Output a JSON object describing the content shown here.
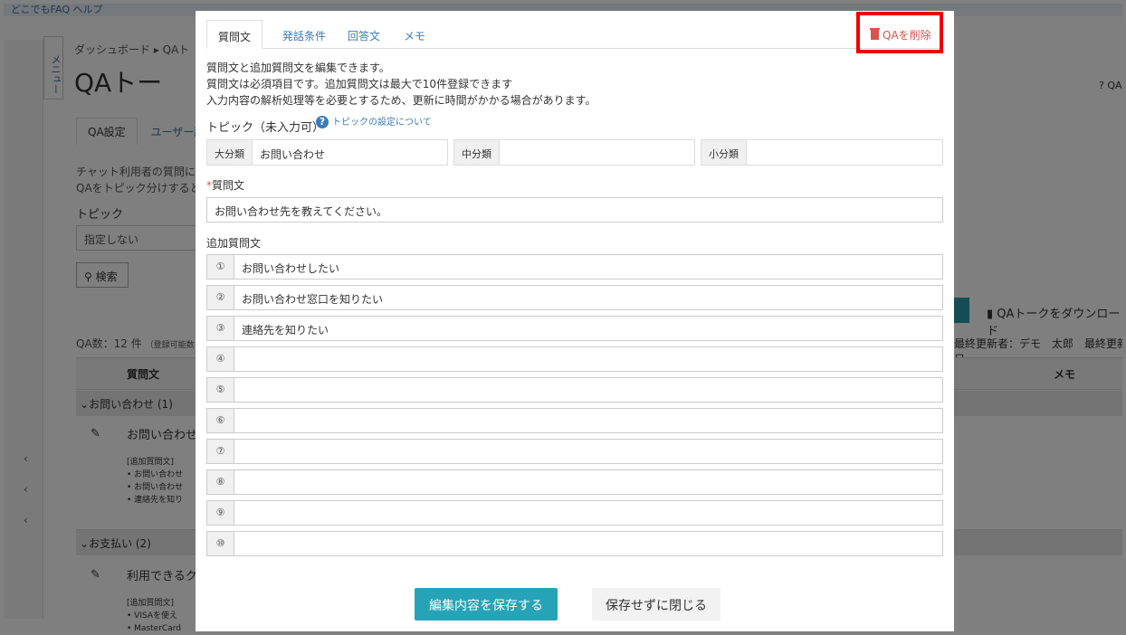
{
  "background": {
    "topbar_text": "どこでもFAQ ヘルプ",
    "menu_label": "メニュー",
    "breadcrumb": "ダッシュボード ▸ QAト",
    "page_title": "QAトー",
    "tabs": [
      "QA設定",
      "ユーザー辞"
    ],
    "desc_lines": [
      "チャット利用者の質問に",
      "QAをトピック分けすると"
    ],
    "topic_label": "トピック",
    "topic_select": "指定しない",
    "search_button": "検索",
    "qa_count": "QA数：12 件",
    "qa_count_sub": "（登録可能数",
    "col_question": "質問文",
    "col_memo": "メモ",
    "group1": "お問い合わせ (1)",
    "group2": "お支払い (2)",
    "row1_title": "お問い合わせ先",
    "row1_sub_title": "[追加質問文]",
    "row1_subs": [
      "お問い合わせ",
      "お問い合わせ",
      "連絡先を知り"
    ],
    "row2_title": "利用できるクレ",
    "row2_sub_title": "[追加質問文]",
    "row2_subs": [
      "VISAを使え",
      "MasterCard"
    ],
    "download_label": "QAトークをダウンロード",
    "updated_by": "最終更新者：デモ　太郎　最終更新日",
    "help_text": "QA"
  },
  "modal": {
    "tabs": [
      "質問文",
      "発話条件",
      "回答文",
      "メモ"
    ],
    "delete_button": "QAを削除",
    "info_lines": [
      "質問文と追加質問文を編集できます。",
      "質問文は必須項目です。追加質問文は最大で10件登録できます",
      "入力内容の解析処理等を必要とするため、更新に時間がかかる場合があります。"
    ],
    "topic_label": "トピック（未入力可）",
    "topic_help": "トピックの設定について",
    "category_large_label": "大分類",
    "category_large_value": "お問い合わせ",
    "category_mid_label": "中分類",
    "category_mid_value": "",
    "category_small_label": "小分類",
    "category_small_value": "",
    "question_required_mark": "*",
    "question_label": "質問文",
    "question_value": "お問い合わせ先を教えてください。",
    "additional_label": "追加質問文",
    "additional": [
      {
        "num": "①",
        "value": "お問い合わせしたい"
      },
      {
        "num": "②",
        "value": "お問い合わせ窓口を知りたい"
      },
      {
        "num": "③",
        "value": "連絡先を知りたい"
      },
      {
        "num": "④",
        "value": ""
      },
      {
        "num": "⑤",
        "value": ""
      },
      {
        "num": "⑥",
        "value": ""
      },
      {
        "num": "⑦",
        "value": ""
      },
      {
        "num": "⑧",
        "value": ""
      },
      {
        "num": "⑨",
        "value": ""
      },
      {
        "num": "⑩",
        "value": ""
      }
    ],
    "save_button": "編集内容を保存する",
    "close_button": "保存せずに閉じる"
  },
  "colors": {
    "accent": "#27a3b8",
    "link": "#3b7bbf",
    "danger": "#d9534f",
    "highlight_border": "#ee0000"
  }
}
